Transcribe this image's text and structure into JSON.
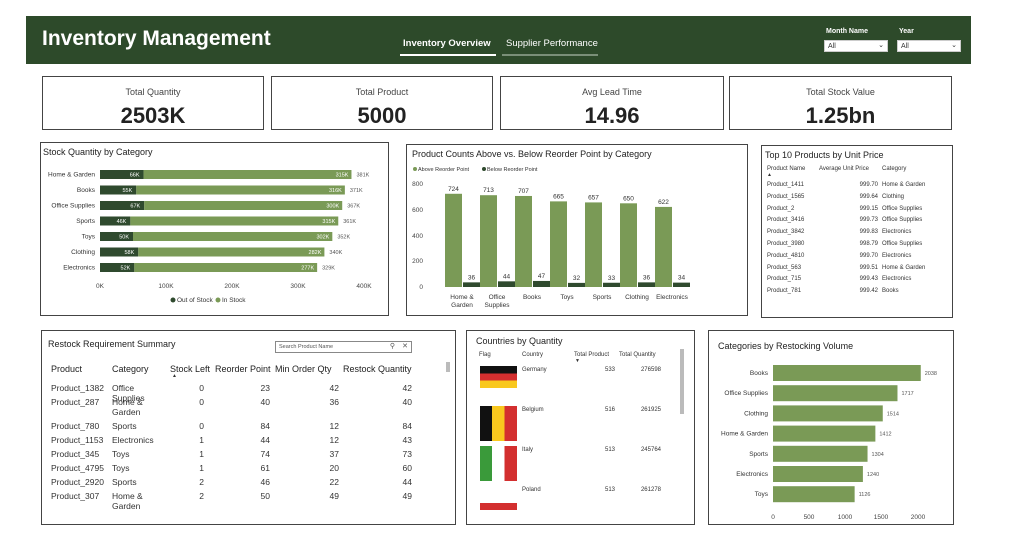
{
  "header": {
    "title": "Inventory Management",
    "tabs": [
      {
        "label": "Inventory Overview",
        "active": true
      },
      {
        "label": "Supplier Performance",
        "active": false
      }
    ],
    "filters": [
      {
        "label": "Month Name",
        "value": "All"
      },
      {
        "label": "Year",
        "value": "All"
      }
    ],
    "bg_color": "#2d4a2a"
  },
  "kpis": [
    {
      "label": "Total Quantity",
      "value": "2503K"
    },
    {
      "label": "Total Product",
      "value": "5000"
    },
    {
      "label": "Avg Lead Time",
      "value": "14.96"
    },
    {
      "label": "Total Stock Value",
      "value": "1.25bn"
    }
  ],
  "stock_chart": {
    "title": "Stock Quantity by Category",
    "x_ticks": [
      "0K",
      "100K",
      "200K",
      "300K",
      "400K"
    ],
    "legend": [
      "Out of Stock",
      "In Stock"
    ]
  },
  "reorder_chart": {
    "title": "Product Counts Above vs. Below Reorder Point by Category",
    "legend": [
      "Above Reorder Point",
      "Below Reorder Point"
    ],
    "y_ticks": [
      "800",
      "600",
      "400",
      "200",
      "0"
    ],
    "categories": [
      "Home & Garden",
      "Office Supplies",
      "Books",
      "Toys",
      "Sports",
      "Clothing",
      "Electronics"
    ]
  },
  "top10": {
    "title": "Top 10 Products by Unit Price",
    "columns": [
      "Product Name",
      "Average Unit Price",
      "Category"
    ],
    "rows": [
      [
        "Product_1411",
        "999.70",
        "Home & Garden"
      ],
      [
        "Product_1565",
        "999.64",
        "Clothing"
      ],
      [
        "Product_2",
        "999.15",
        "Office Supplies"
      ],
      [
        "Product_3416",
        "999.73",
        "Office Supplies"
      ],
      [
        "Product_3842",
        "999.83",
        "Electronics"
      ],
      [
        "Product_3980",
        "998.79",
        "Office Supplies"
      ],
      [
        "Product_4810",
        "999.70",
        "Electronics"
      ],
      [
        "Product_563",
        "999.51",
        "Home & Garden"
      ],
      [
        "Product_715",
        "999.43",
        "Electronics"
      ],
      [
        "Product_781",
        "999.42",
        "Books"
      ]
    ]
  },
  "restock": {
    "title": "Restock Requirement Summary",
    "search_placeholder": "Search Product Name",
    "columns": [
      "Product",
      "Category",
      "Stock Left",
      "Reorder Point",
      "Min Order Qty",
      "Restock Quantity"
    ],
    "rows": [
      [
        "Product_1382",
        "Office Supplies",
        "0",
        "23",
        "42",
        "42"
      ],
      [
        "Product_287",
        "Home & Garden",
        "0",
        "40",
        "36",
        "40"
      ],
      [
        "Product_780",
        "Sports",
        "0",
        "84",
        "12",
        "84"
      ],
      [
        "Product_1153",
        "Electronics",
        "1",
        "44",
        "12",
        "43"
      ],
      [
        "Product_345",
        "Toys",
        "1",
        "74",
        "37",
        "73"
      ],
      [
        "Product_4795",
        "Toys",
        "1",
        "61",
        "20",
        "60"
      ],
      [
        "Product_2920",
        "Sports",
        "2",
        "46",
        "22",
        "44"
      ],
      [
        "Product_307",
        "Home & Garden",
        "2",
        "50",
        "49",
        "49"
      ]
    ]
  },
  "countries": {
    "title": "Countries by Quantity",
    "columns": [
      "Flag",
      "Country",
      "Total Product",
      "Total Quantity"
    ],
    "rows": [
      {
        "country": "Germany",
        "products": "533",
        "quantity": "276598",
        "flag": "germany-flag-icon"
      },
      {
        "country": "Belgium",
        "products": "516",
        "quantity": "261925",
        "flag": "belgium-flag-icon"
      },
      {
        "country": "Italy",
        "products": "513",
        "quantity": "245764",
        "flag": "italy-flag-icon"
      },
      {
        "country": "Poland",
        "products": "513",
        "quantity": "261278",
        "flag": "poland-flag-icon"
      }
    ]
  },
  "restocking_chart": {
    "title": "Categories by Restocking Volume",
    "x_ticks": [
      "0",
      "500",
      "1000",
      "1500",
      "2000"
    ]
  },
  "chart_data": [
    {
      "type": "bar",
      "orientation": "horizontal",
      "stacked": true,
      "title": "Stock Quantity by Category",
      "categories": [
        "Home & Garden",
        "Books",
        "Office Supplies",
        "Sports",
        "Toys",
        "Clothing",
        "Electronics"
      ],
      "series": [
        {
          "name": "Out of Stock",
          "values": [
            66,
            55,
            67,
            46,
            50,
            58,
            52
          ],
          "labels": [
            "66K",
            "55K",
            "67K",
            "46K",
            "50K",
            "58K",
            "52K"
          ],
          "color": "#2f4a2e"
        },
        {
          "name": "In Stock",
          "values": [
            315,
            316,
            300,
            315,
            302,
            282,
            277
          ],
          "labels": [
            "315K",
            "316K",
            "300K",
            "315K",
            "302K",
            "282K",
            "277K"
          ],
          "color": "#7a9a56"
        }
      ],
      "totals": [
        "381K",
        "371K",
        "367K",
        "361K",
        "352K",
        "340K",
        "329K"
      ],
      "xlim": [
        0,
        400
      ],
      "legend": "bottom"
    },
    {
      "type": "bar",
      "title": "Product Counts Above vs. Below Reorder Point by Category",
      "categories": [
        "Home & Garden",
        "Office Supplies",
        "Books",
        "Toys",
        "Sports",
        "Clothing",
        "Electronics"
      ],
      "series": [
        {
          "name": "Above Reorder Point",
          "values": [
            724,
            713,
            707,
            665,
            657,
            650,
            622
          ],
          "color": "#7a9a56"
        },
        {
          "name": "Below Reorder Point",
          "values": [
            36,
            44,
            47,
            32,
            33,
            36,
            34
          ],
          "color": "#2f4a2e"
        }
      ],
      "ylim": [
        0,
        800
      ],
      "legend": "top-left"
    },
    {
      "type": "bar",
      "orientation": "horizontal",
      "title": "Categories by Restocking Volume",
      "categories": [
        "Books",
        "Office Supplies",
        "Clothing",
        "Home & Garden",
        "Sports",
        "Electronics",
        "Toys"
      ],
      "values": [
        2038,
        1717,
        1514,
        1412,
        1304,
        1240,
        1126
      ],
      "xlim": [
        0,
        2000
      ],
      "color": "#7a9a56"
    }
  ]
}
